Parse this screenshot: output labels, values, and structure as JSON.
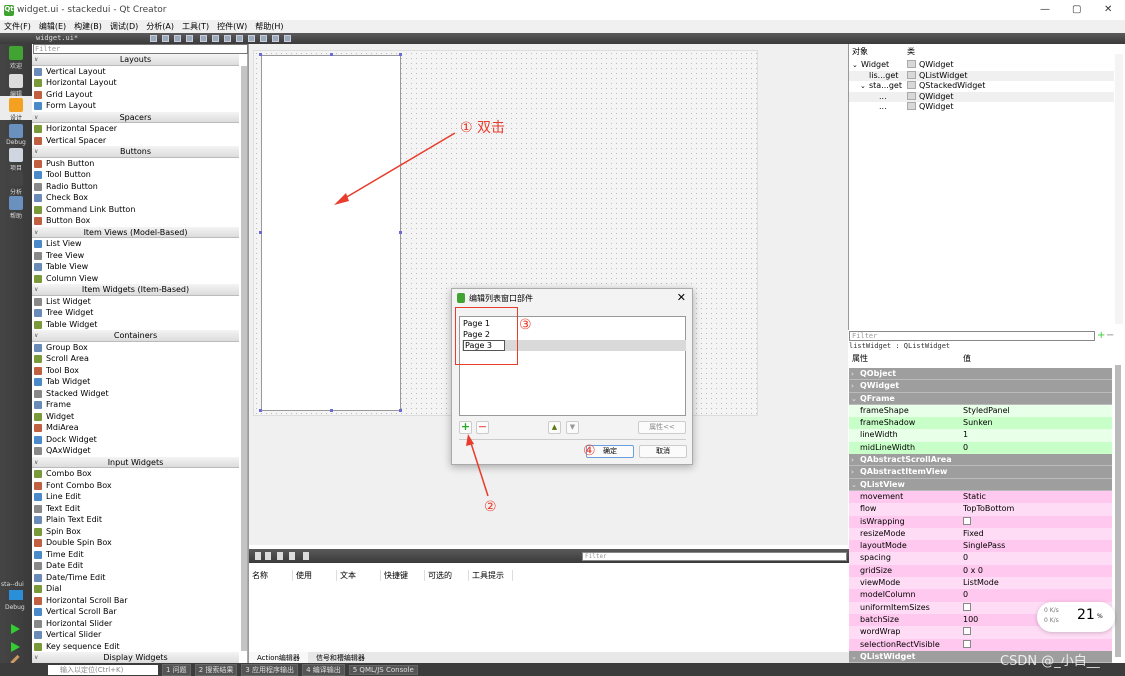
{
  "window": {
    "title": "widget.ui - stackedui - Qt Creator",
    "controls": [
      "—",
      "▢",
      "✕"
    ]
  },
  "menu": [
    "文件(F)",
    "编辑(E)",
    "构建(B)",
    "调试(D)",
    "分析(A)",
    "工具(T)",
    "控件(W)",
    "帮助(H)"
  ],
  "toolbar": {
    "file": "widget.ui*"
  },
  "modes": [
    {
      "label": "欢迎",
      "color": "#41a332"
    },
    {
      "label": "编辑",
      "color": "#dcdcdc"
    },
    {
      "label": "设计",
      "color": "#f4a020"
    },
    {
      "label": "Debug",
      "color": "#6a90c0"
    },
    {
      "label": "项目",
      "color": "#cfd6e0"
    },
    {
      "label": "分析",
      "color": "#444"
    },
    {
      "label": "帮助",
      "color": "#6a90c0"
    }
  ],
  "kit": {
    "project": "sta--dui",
    "mode": "Debug"
  },
  "widget_box": {
    "filter_placeholder": "Filter",
    "categories": [
      {
        "name": "Layouts",
        "items": [
          "Vertical Layout",
          "Horizontal Layout",
          "Grid Layout",
          "Form Layout"
        ]
      },
      {
        "name": "Spacers",
        "items": [
          "Horizontal Spacer",
          "Vertical Spacer"
        ]
      },
      {
        "name": "Buttons",
        "items": [
          "Push Button",
          "Tool Button",
          "Radio Button",
          "Check Box",
          "Command Link Button",
          "Button Box"
        ]
      },
      {
        "name": "Item Views (Model-Based)",
        "items": [
          "List View",
          "Tree View",
          "Table View",
          "Column View"
        ]
      },
      {
        "name": "Item Widgets (Item-Based)",
        "items": [
          "List Widget",
          "Tree Widget",
          "Table Widget"
        ]
      },
      {
        "name": "Containers",
        "items": [
          "Group Box",
          "Scroll Area",
          "Tool Box",
          "Tab Widget",
          "Stacked Widget",
          "Frame",
          "Widget",
          "MdiArea",
          "Dock Widget",
          "QAxWidget"
        ]
      },
      {
        "name": "Input Widgets",
        "items": [
          "Combo Box",
          "Font Combo Box",
          "Line Edit",
          "Text Edit",
          "Plain Text Edit",
          "Spin Box",
          "Double Spin Box",
          "Time Edit",
          "Date Edit",
          "Date/Time Edit",
          "Dial",
          "Horizontal Scroll Bar",
          "Vertical Scroll Bar",
          "Horizontal Slider",
          "Vertical Slider",
          "Key sequence Edit"
        ]
      },
      {
        "name": "Display Widgets",
        "items": []
      }
    ]
  },
  "action_editor": {
    "filter_placeholder": "Filter",
    "columns": [
      "名称",
      "使用",
      "文本",
      "快捷键",
      "可选的",
      "工具提示"
    ],
    "tabs": [
      "Action编辑器",
      "信号和槽编辑器"
    ]
  },
  "object_inspector": {
    "headers": [
      "对象",
      "类"
    ],
    "rows": [
      {
        "object": "Widget",
        "class": "QWidget"
      },
      {
        "object": "lis...get",
        "class": "QListWidget"
      },
      {
        "object": "sta...get",
        "class": "QStackedWidget"
      },
      {
        "object": "...",
        "class": "QWidget"
      },
      {
        "object": "...",
        "class": "QWidget"
      }
    ]
  },
  "property_editor": {
    "filter_placeholder": "Filter",
    "object": "listWidget : QListWidget",
    "headers": [
      "属性",
      "值"
    ],
    "rows": [
      {
        "name": "QObject",
        "group": true
      },
      {
        "name": "QWidget",
        "group": true
      },
      {
        "name": "QFrame",
        "group": true
      },
      {
        "name": "frameShape",
        "value": "StyledPanel",
        "tone": "g1"
      },
      {
        "name": "frameShadow",
        "value": "Sunken",
        "tone": "g2"
      },
      {
        "name": "lineWidth",
        "value": "1",
        "tone": "g1"
      },
      {
        "name": "midLineWidth",
        "value": "0",
        "tone": "g2"
      },
      {
        "name": "QAbstractScrollArea",
        "group": true
      },
      {
        "name": "QAbstractItemView",
        "group": true
      },
      {
        "name": "QListView",
        "group": true
      },
      {
        "name": "movement",
        "value": "Static",
        "tone": "p2"
      },
      {
        "name": "flow",
        "value": "TopToBottom",
        "tone": "p1"
      },
      {
        "name": "isWrapping",
        "checkbox": false,
        "tone": "p2"
      },
      {
        "name": "resizeMode",
        "value": "Fixed",
        "tone": "p1"
      },
      {
        "name": "layoutMode",
        "value": "SinglePass",
        "tone": "p2"
      },
      {
        "name": "spacing",
        "value": "0",
        "tone": "p1"
      },
      {
        "name": "gridSize",
        "value": "0 x 0",
        "tone": "p2"
      },
      {
        "name": "viewMode",
        "value": "ListMode",
        "tone": "p1"
      },
      {
        "name": "modelColumn",
        "value": "0",
        "tone": "p2"
      },
      {
        "name": "uniformItemSizes",
        "checkbox": false,
        "tone": "p1"
      },
      {
        "name": "batchSize",
        "value": "100",
        "tone": "p2"
      },
      {
        "name": "wordWrap",
        "checkbox": false,
        "tone": "p1"
      },
      {
        "name": "selectionRectVisible",
        "checkbox": false,
        "tone": "p2"
      },
      {
        "name": "QListWidget",
        "group": true
      }
    ]
  },
  "status_bar": {
    "locator_placeholder": "输入以定位(Ctrl+K)",
    "panes": [
      "1 问题",
      "2 搜索结果",
      "3 应用程序输出",
      "4 编译输出",
      "5 QML/JS Console"
    ]
  },
  "dialog": {
    "title": "编辑列表窗口部件",
    "items": [
      "Page 1",
      "Page 2",
      "Page 3"
    ],
    "properties_button": "属性<<",
    "ok": "确定",
    "cancel": "取消"
  },
  "annotations": {
    "step1": "① 双击",
    "step2": "②",
    "step3": "③",
    "step4": "④",
    "color": "#e83c2c"
  },
  "net_monitor": {
    "up": "0 K/s",
    "down": "0 K/s",
    "percent": "21",
    "unit": "%"
  },
  "watermark": "CSDN @_小白__"
}
